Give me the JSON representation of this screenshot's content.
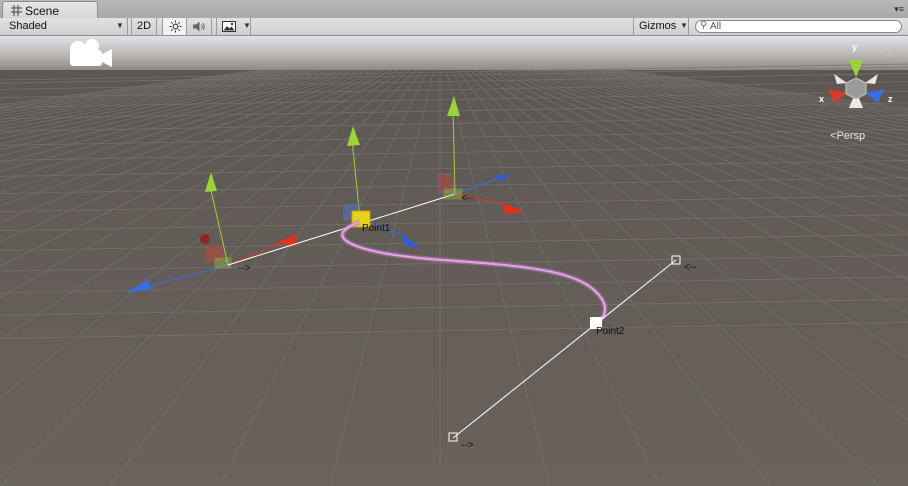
{
  "tab": {
    "title": "Scene",
    "icon": "grid-icon"
  },
  "toolbar": {
    "shading_mode": "Shaded",
    "mode_2d": "2D",
    "lighting_icon": "sun-icon",
    "audio_icon": "speaker-icon",
    "effects_icon": "image-icon",
    "gizmos_label": "Gizmos",
    "search_placeholder": "All"
  },
  "viewport": {
    "camera_icon": "camera-icon",
    "points": [
      {
        "name": "Point1",
        "tangent_in": "-->",
        "tangent_out": "<--"
      },
      {
        "name": "Point2",
        "tangent_in": "<--",
        "tangent_out": "-->"
      }
    ],
    "curve_color": "#e8a3e8",
    "orientation": {
      "axis_y": "y",
      "axis_x": "x",
      "axis_z": "z",
      "projection": "Persp",
      "colors": {
        "x": "#d83a2a",
        "y": "#9ad43a",
        "z": "#3a6ee0"
      }
    }
  }
}
